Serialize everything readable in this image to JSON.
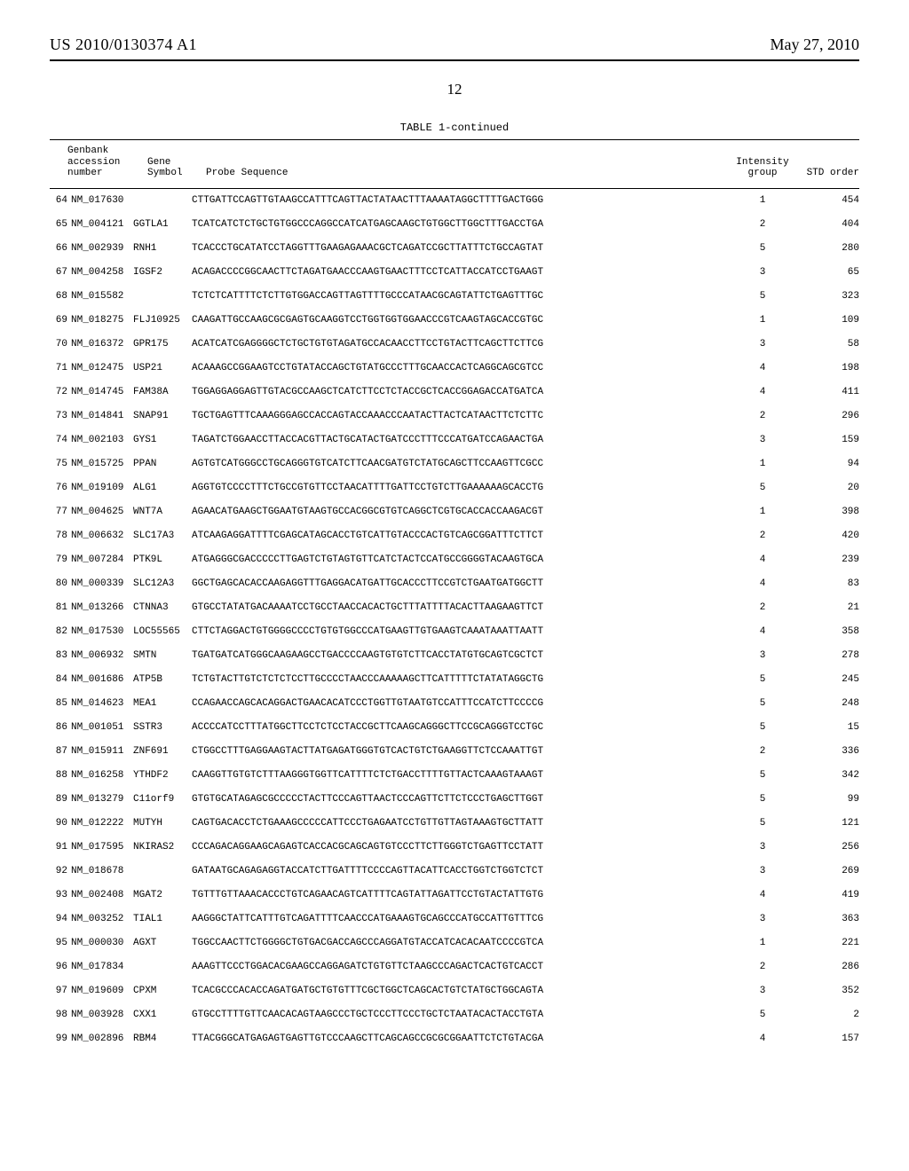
{
  "header": {
    "left": "US 2010/0130374 A1",
    "right": "May 27, 2010"
  },
  "page_number": "12",
  "table": {
    "caption": "TABLE 1-continued",
    "head": {
      "accession_l1": "Genbank",
      "accession_l2": "accession",
      "accession_l3": "number",
      "gene_l1": "Gene",
      "gene_l2": "Symbol",
      "probe": "Probe Sequence",
      "intensity_l1": "Intensity",
      "intensity_l2": "group",
      "std": "STD order"
    },
    "rows": [
      {
        "idx": "64",
        "acc": "NM_017630",
        "sym": "",
        "seq": "CTTGATTCCAGTTGTAAGCCATTTCAGTTACTATAACTTTAAAATAGGCTTTTGACTGGG",
        "int": "1",
        "std": "454"
      },
      {
        "idx": "65",
        "acc": "NM_004121",
        "sym": "GGTLA1",
        "seq": "TCATCATCTCTGCTGTGGCCCAGGCCATCATGAGCAAGCTGTGGCTTGGCTTTGACCTGA",
        "int": "2",
        "std": "404"
      },
      {
        "idx": "66",
        "acc": "NM_002939",
        "sym": "RNH1",
        "seq": "TCACCCTGCATATCCTAGGTTTGAAGAGAAACGCTCAGATCCGCTTATTTCTGCCAGTAT",
        "int": "5",
        "std": "280"
      },
      {
        "idx": "67",
        "acc": "NM_004258",
        "sym": "IGSF2",
        "seq": "ACAGACCCCGGCAACTTCTAGATGAACCCAAGTGAACTTTCCTCATTACCATCCTGAAGT",
        "int": "3",
        "std": "65"
      },
      {
        "idx": "68",
        "acc": "NM_015582",
        "sym": "",
        "seq": "TCTCTCATTTTCTCTTGTGGACCAGTTAGTTTTGCCCATAACGCAGTATTCTGAGTTTGC",
        "int": "5",
        "std": "323"
      },
      {
        "idx": "69",
        "acc": "NM_018275",
        "sym": "FLJ10925",
        "seq": "CAAGATTGCCAAGCGCGAGTGCAAGGTCCTGGTGGTGGAACCCGTCAAGTAGCACCGTGC",
        "int": "1",
        "std": "109"
      },
      {
        "idx": "70",
        "acc": "NM_016372",
        "sym": "GPR175",
        "seq": "ACATCATCGAGGGGCTCTGCTGTGTAGATGCCACAACCTTCCTGTACTTCAGCTTCTTCG",
        "int": "3",
        "std": "58"
      },
      {
        "idx": "71",
        "acc": "NM_012475",
        "sym": "USP21",
        "seq": "ACAAAGCCGGAAGTCCTGTATACCAGCTGTATGCCCTTTGCAACCACTCAGGCAGCGTCC",
        "int": "4",
        "std": "198"
      },
      {
        "idx": "72",
        "acc": "NM_014745",
        "sym": "FAM38A",
        "seq": "TGGAGGAGGAGTTGTACGCCAAGCTCATCTTCCTCTACCGCTCACCGGAGACCATGATCA",
        "int": "4",
        "std": "411"
      },
      {
        "idx": "73",
        "acc": "NM_014841",
        "sym": "SNAP91",
        "seq": "TGCTGAGTTTCAAAGGGAGCCACCAGTACCAAACCCAATACTTACTCATAACTTCTCTTC",
        "int": "2",
        "std": "296"
      },
      {
        "idx": "74",
        "acc": "NM_002103",
        "sym": "GYS1",
        "seq": "TAGATCTGGAACCTTACCACGTTACTGCATACTGATCCCTTTCCCATGATCCAGAACTGA",
        "int": "3",
        "std": "159"
      },
      {
        "idx": "75",
        "acc": "NM_015725",
        "sym": "PPAN",
        "seq": "AGTGTCATGGGCCTGCAGGGTGTCATCTTCAACGATGTCTATGCAGCTTCCAAGTTCGCC",
        "int": "1",
        "std": "94"
      },
      {
        "idx": "76",
        "acc": "NM_019109",
        "sym": "ALG1",
        "seq": "AGGTGTCCCCTTTCTGCCGTGTTCCTAACATTTTGATTCCTGTCTTGAAAAAAGCACCTG",
        "int": "5",
        "std": "20"
      },
      {
        "idx": "77",
        "acc": "NM_004625",
        "sym": "WNT7A",
        "seq": "AGAACATGAAGCTGGAATGTAAGTGCCACGGCGTGTCAGGCTCGTGCACCACCAAGACGT",
        "int": "1",
        "std": "398"
      },
      {
        "idx": "78",
        "acc": "NM_006632",
        "sym": "SLC17A3",
        "seq": "ATCAAGAGGATTTTCGAGCATAGCACCTGTCATTGTACCCACTGTCAGCGGATTTCTTCT",
        "int": "2",
        "std": "420"
      },
      {
        "idx": "79",
        "acc": "NM_007284",
        "sym": "PTK9L",
        "seq": "ATGAGGGCGACCCCCTTGAGTCTGTAGTGTTCATCTACTCCATGCCGGGGTACAAGTGCA",
        "int": "4",
        "std": "239"
      },
      {
        "idx": "80",
        "acc": "NM_000339",
        "sym": "SLC12A3",
        "seq": "GGCTGAGCACACCAAGAGGTTTGAGGACATGATTGCACCCTTCCGTCTGAATGATGGCTT",
        "int": "4",
        "std": "83"
      },
      {
        "idx": "81",
        "acc": "NM_013266",
        "sym": "CTNNA3",
        "seq": "GTGCCTATATGACAAAATCCTGCCTAACCACACTGCTTTATTTTACACTTAAGAAGTTCT",
        "int": "2",
        "std": "21"
      },
      {
        "idx": "82",
        "acc": "NM_017530",
        "sym": "LOC55565",
        "seq": "CTTCTAGGACTGTGGGGCCCCTGTGTGGCCCATGAAGTTGTGAAGTCAAATAAATTAATT",
        "int": "4",
        "std": "358"
      },
      {
        "idx": "83",
        "acc": "NM_006932",
        "sym": "SMTN",
        "seq": "TGATGATCATGGGCAAGAAGCCTGACCCCAAGTGTGTCTTCACCTATGTGCAGTCGCTCT",
        "int": "3",
        "std": "278"
      },
      {
        "idx": "84",
        "acc": "NM_001686",
        "sym": "ATP5B",
        "seq": "TCTGTACTTGTCTCTCTCCTTGCCCCTAACCCAAAAAGCTTCATTTTTCTATATAGGCTG",
        "int": "5",
        "std": "245"
      },
      {
        "idx": "85",
        "acc": "NM_014623",
        "sym": "MEA1",
        "seq": "CCAGAACCAGCACAGGACTGAACACATCCCTGGTTGTAATGTCCATTTCCATCTTCCCCG",
        "int": "5",
        "std": "248"
      },
      {
        "idx": "86",
        "acc": "NM_001051",
        "sym": "SSTR3",
        "seq": "ACCCCATCCTTTATGGCTTCCTCTCCTACCGCTTCAAGCAGGGCTTCCGCAGGGTCCTGC",
        "int": "5",
        "std": "15"
      },
      {
        "idx": "87",
        "acc": "NM_015911",
        "sym": "ZNF691",
        "seq": "CTGGCCTTTGAGGAAGTACTTATGAGATGGGTGTCACTGTCTGAAGGTTCTCCAAATTGT",
        "int": "2",
        "std": "336"
      },
      {
        "idx": "88",
        "acc": "NM_016258",
        "sym": "YTHDF2",
        "seq": "CAAGGTTGTGTCTTTAAGGGTGGTTCATTTTCTCTGACCTTTTGTTACTCAAAGTAAAGT",
        "int": "5",
        "std": "342"
      },
      {
        "idx": "89",
        "acc": "NM_013279",
        "sym": "C11orf9",
        "seq": "GTGTGCATAGAGCGCCCCCTACTTCCCAGTTAACTCCCAGTTCTTCTCCCTGAGCTTGGT",
        "int": "5",
        "std": "99"
      },
      {
        "idx": "90",
        "acc": "NM_012222",
        "sym": "MUTYH",
        "seq": "CAGTGACACCTCTGAAAGCCCCCATTCCCTGAGAATCCTGTTGTTAGTAAAGTGCTTATT",
        "int": "5",
        "std": "121"
      },
      {
        "idx": "91",
        "acc": "NM_017595",
        "sym": "NKIRAS2",
        "seq": "CCCAGACAGGAAGCAGAGTCACCACGCAGCAGTGTCCCTTCTTGGGTCTGAGTTCCTATT",
        "int": "3",
        "std": "256"
      },
      {
        "idx": "92",
        "acc": "NM_018678",
        "sym": "",
        "seq": "GATAATGCAGAGAGGTACCATCTTGATTTTCCCCAGTTACATTCACCTGGTCTGGTCTCT",
        "int": "3",
        "std": "269"
      },
      {
        "idx": "93",
        "acc": "NM_002408",
        "sym": "MGAT2",
        "seq": "TGTTTGTTAAACACCCTGTCAGAACAGTCATTTTCAGTATTAGATTCCTGTACTATTGTG",
        "int": "4",
        "std": "419"
      },
      {
        "idx": "94",
        "acc": "NM_003252",
        "sym": "TIAL1",
        "seq": "AAGGGCTATTCATTTGTCAGATTTTCAACCCATGAAAGTGCAGCCCATGCCATTGTTTCG",
        "int": "3",
        "std": "363"
      },
      {
        "idx": "95",
        "acc": "NM_000030",
        "sym": "AGXT",
        "seq": "TGGCCAACTTCTGGGGCTGTGACGACCAGCCCAGGATGTACCATCACACAATCCCCGTCA",
        "int": "1",
        "std": "221"
      },
      {
        "idx": "96",
        "acc": "NM_017834",
        "sym": "",
        "seq": "AAAGTTCCCTGGACACGAAGCCAGGAGATCTGTGTTCTAAGCCCAGACTCACTGTCACCT",
        "int": "2",
        "std": "286"
      },
      {
        "idx": "97",
        "acc": "NM_019609",
        "sym": "CPXM",
        "seq": "TCACGCCCACACCAGATGATGCTGTGTTTCGCTGGCTCAGCACTGTCTATGCTGGCAGTA",
        "int": "3",
        "std": "352"
      },
      {
        "idx": "98",
        "acc": "NM_003928",
        "sym": "CXX1",
        "seq": "GTGCCTTTTGTTCAACACAGTAAGCCCTGCTCCCTTCCCTGCTCTAATACACTACCTGTA",
        "int": "5",
        "std": "2"
      },
      {
        "idx": "99",
        "acc": "NM_002896",
        "sym": "RBM4",
        "seq": "TTACGGGCATGAGAGTGAGTTGTCCCAAGCTTCAGCAGCCGCGCGGAATTCTCTGTACGA",
        "int": "4",
        "std": "157"
      }
    ]
  }
}
